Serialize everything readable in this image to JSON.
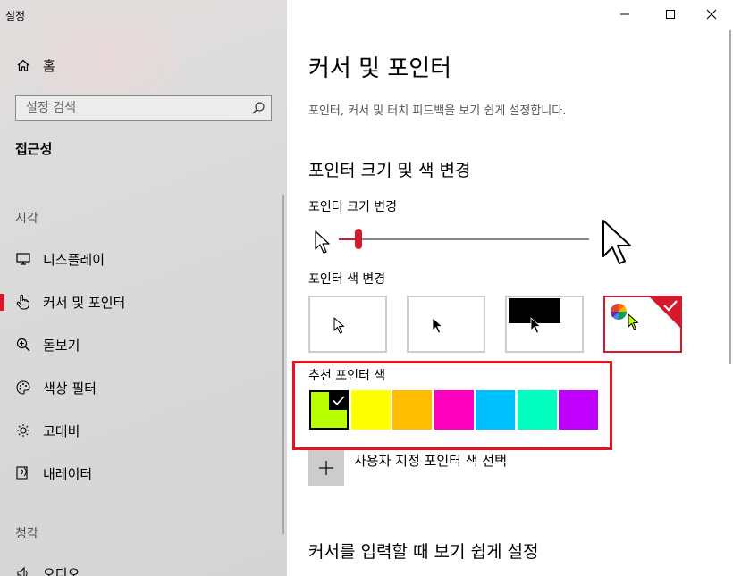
{
  "app": {
    "title": "설정"
  },
  "nav": {
    "home_label": "홈",
    "search": {
      "placeholder": "설정 검색",
      "value": ""
    },
    "section_title": "접근성",
    "group_vision": "시각",
    "group_hearing": "청각",
    "items": [
      {
        "label": "디스플레이",
        "icon": "display-icon",
        "active": false
      },
      {
        "label": "커서 및 포인터",
        "icon": "cursor-hand-icon",
        "active": true
      },
      {
        "label": "돋보기",
        "icon": "magnifier-icon",
        "active": false
      },
      {
        "label": "색상 필터",
        "icon": "palette-icon",
        "active": false
      },
      {
        "label": "고대비",
        "icon": "sun-icon",
        "active": false
      },
      {
        "label": "내레이터",
        "icon": "narrator-icon",
        "active": false
      },
      {
        "label": "오디오",
        "icon": "speaker-icon",
        "active": false
      }
    ]
  },
  "page": {
    "title": "커서 및 포인터",
    "description": "포인터, 커서 및 터치 피드백을 보기 쉽게 설정합니다.",
    "section1_title": "포인터 크기 및 색 변경",
    "size_label": "포인터 크기 변경",
    "size_level": 0.08,
    "color_label": "포인터 색 변경",
    "color_options": [
      "white",
      "black",
      "inverted",
      "custom"
    ],
    "selected_color_option": "custom",
    "recommended_label": "추천 포인터 색",
    "recommended_colors": [
      "#b9ff00",
      "#ffff00",
      "#ffbf00",
      "#ff00bf",
      "#00bfff",
      "#00ffbf",
      "#bf00ff"
    ],
    "selected_recommended": "#b9ff00",
    "custom_color_label": "사용자 지정 포인터 색 선택",
    "section2_title": "커서를 입력할 때 보기 쉽게 설정"
  },
  "colors": {
    "accent": "#d6182c",
    "highlight_box": "#e3141e"
  }
}
